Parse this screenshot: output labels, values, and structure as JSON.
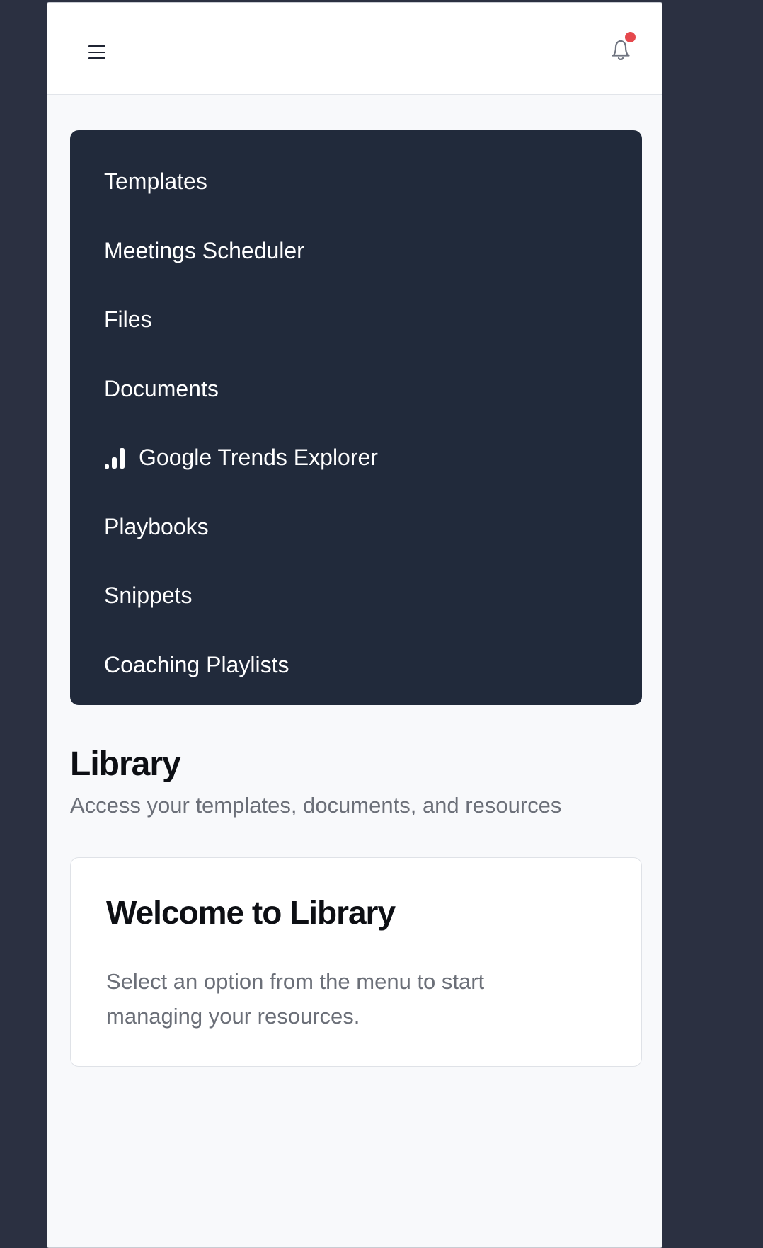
{
  "header": {
    "menu_icon": "hamburger-menu-icon",
    "notification_icon": "bell-icon",
    "has_unread_notifications": true,
    "notification_dot_color": "#e5484d"
  },
  "menu": {
    "background_color": "#212a3b",
    "items": [
      {
        "label": "Templates",
        "icon": null
      },
      {
        "label": "Meetings Scheduler",
        "icon": null
      },
      {
        "label": "Files",
        "icon": null
      },
      {
        "label": "Documents",
        "icon": null
      },
      {
        "label": "Google Trends Explorer",
        "icon": "bar-chart-icon"
      },
      {
        "label": "Playbooks",
        "icon": null
      },
      {
        "label": "Snippets",
        "icon": null
      },
      {
        "label": "Coaching Playlists",
        "icon": null
      }
    ]
  },
  "page": {
    "title": "Library",
    "subtitle": "Access your templates, documents, and resources"
  },
  "welcome_card": {
    "title": "Welcome to Library",
    "text": "Select an option from the menu to start managing your resources."
  }
}
